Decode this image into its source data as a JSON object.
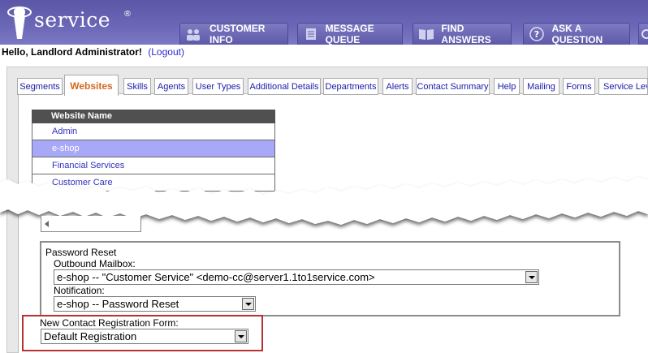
{
  "app": {
    "logo_text": "service",
    "logo_mark": "i",
    "registered": "®"
  },
  "nav": {
    "buttons": [
      {
        "label": "CUSTOMER INFO",
        "icon": "people-icon"
      },
      {
        "label": "MESSAGE QUEUE",
        "icon": "document-icon"
      },
      {
        "label": "FIND ANSWERS",
        "icon": "book-icon"
      },
      {
        "label": "ASK A QUESTION",
        "icon": "question-icon"
      }
    ]
  },
  "greeting": {
    "text": "Hello, Landlord Administrator!",
    "logout": "(Logout)"
  },
  "tabs": [
    "Segments",
    "Websites",
    "Skills",
    "Agents",
    "User Types",
    "Additional Details",
    "Departments",
    "Alerts",
    "Contact Summary",
    "Help",
    "Mailing",
    "Forms",
    "Service Lev"
  ],
  "active_tab": "Websites",
  "website_list": {
    "header": "Website Name",
    "rows": [
      "Admin",
      "e-shop",
      "Financial Services",
      "Customer Care"
    ],
    "selected": "e-shop"
  },
  "password_reset": {
    "title": "Password Reset",
    "mailbox_label": "Outbound Mailbox:",
    "mailbox_value": "e-shop -- \"Customer Service\" <demo-cc@server1.1to1service.com>",
    "notification_label": "Notification:",
    "notification_value": "e-shop -- Password Reset"
  },
  "registration": {
    "label": "New Contact Registration Form:",
    "value": "Default Registration"
  },
  "colors": {
    "header": "#6c68b8",
    "active_tab": "#d2691e",
    "selected_row": "#a8a8f8",
    "highlight_border": "#b83030"
  }
}
